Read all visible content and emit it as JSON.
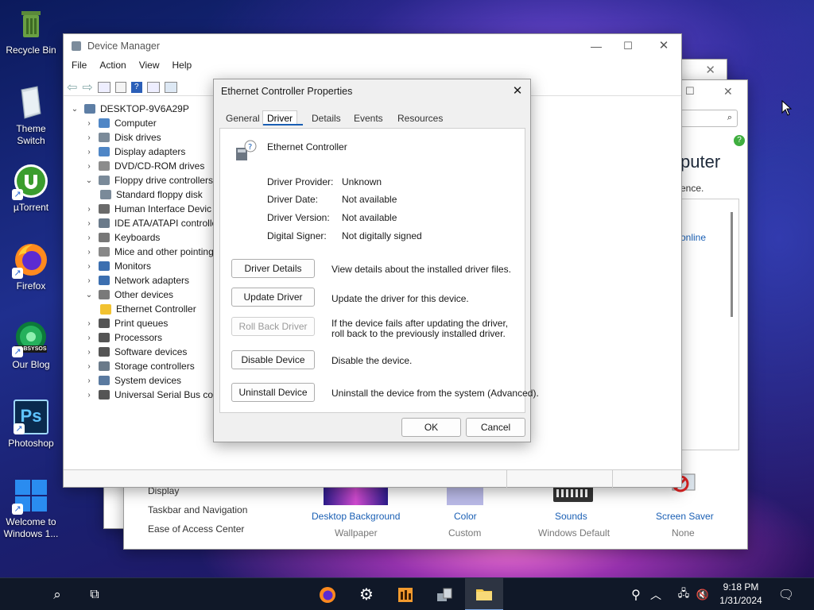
{
  "desktop": {
    "icons": [
      {
        "label": "Recycle Bin",
        "icon": "recycle-bin-icon"
      },
      {
        "label": "Theme Switch",
        "icon": "theme-switch-icon"
      },
      {
        "label": "µTorrent",
        "icon": "utorrent-icon"
      },
      {
        "label": "Firefox",
        "icon": "firefox-icon"
      },
      {
        "label": "Our Blog",
        "icon": "blog-icon",
        "badge": "LABSYSOS"
      },
      {
        "label": "Photoshop",
        "icon": "photoshop-icon",
        "glyph": "Ps"
      },
      {
        "label": "Welcome to Windows 1...",
        "icon": "windows-logo-icon"
      }
    ]
  },
  "device_manager": {
    "title": "Device Manager",
    "menu": [
      "File",
      "Action",
      "View",
      "Help"
    ],
    "root": "DESKTOP-9V6A29P",
    "tree": [
      {
        "label": "Computer",
        "expanded": false
      },
      {
        "label": "Disk drives",
        "expanded": false
      },
      {
        "label": "Display adapters",
        "expanded": false
      },
      {
        "label": "DVD/CD-ROM drives",
        "expanded": false
      },
      {
        "label": "Floppy drive controllers",
        "expanded": true
      },
      {
        "label": "Standard floppy disk",
        "child": true
      },
      {
        "label": "Human Interface Devic",
        "expanded": false
      },
      {
        "label": "IDE ATA/ATAPI controlle",
        "expanded": false
      },
      {
        "label": "Keyboards",
        "expanded": false
      },
      {
        "label": "Mice and other pointing",
        "expanded": false
      },
      {
        "label": "Monitors",
        "expanded": false
      },
      {
        "label": "Network adapters",
        "expanded": false
      },
      {
        "label": "Other devices",
        "expanded": true
      },
      {
        "label": "Ethernet Controller",
        "child": true,
        "warning": true
      },
      {
        "label": "Print queues",
        "expanded": false
      },
      {
        "label": "Processors",
        "expanded": false
      },
      {
        "label": "Software devices",
        "expanded": false
      },
      {
        "label": "Storage controllers",
        "expanded": false
      },
      {
        "label": "System devices",
        "expanded": false
      },
      {
        "label": "Universal Serial Bus con",
        "expanded": false
      }
    ]
  },
  "background_window": {
    "heading": "puter",
    "text_fragment": "ence.",
    "link": "online",
    "left_links": [
      "Display",
      "Taskbar and Navigation",
      "Ease of Access Center"
    ],
    "personalization": [
      {
        "label": "Desktop Background",
        "value": "Wallpaper"
      },
      {
        "label": "Color",
        "value": "Custom"
      },
      {
        "label": "Sounds",
        "value": "Windows Default"
      },
      {
        "label": "Screen Saver",
        "value": "None"
      }
    ]
  },
  "properties": {
    "title": "Ethernet Controller Properties",
    "tabs": [
      "General",
      "Driver",
      "Details",
      "Events",
      "Resources"
    ],
    "active_tab": "Driver",
    "device_name": "Ethernet Controller",
    "fields": [
      {
        "label": "Driver Provider:",
        "value": "Unknown"
      },
      {
        "label": "Driver Date:",
        "value": "Not available"
      },
      {
        "label": "Driver Version:",
        "value": "Not available"
      },
      {
        "label": "Digital Signer:",
        "value": "Not digitally signed"
      }
    ],
    "actions": [
      {
        "button": "Driver Details",
        "description": "View details about the installed driver files.",
        "enabled": true
      },
      {
        "button": "Update Driver",
        "description": "Update the driver for this device.",
        "enabled": true
      },
      {
        "button": "Roll Back Driver",
        "description": "If the device fails after updating the driver, roll back to the previously installed driver.",
        "enabled": false
      },
      {
        "button": "Disable Device",
        "description": "Disable the device.",
        "enabled": true
      },
      {
        "button": "Uninstall Device",
        "description": "Uninstall the device from the system (Advanced).",
        "enabled": true
      }
    ],
    "ok_label": "OK",
    "cancel_label": "Cancel"
  },
  "taskbar": {
    "time": "9:18 PM",
    "date": "1/31/2024",
    "pinned": [
      "search-icon",
      "task-view-icon",
      "firefox-icon",
      "settings-icon",
      "app-icon",
      "device-manager-icon",
      "file-explorer-icon"
    ]
  }
}
